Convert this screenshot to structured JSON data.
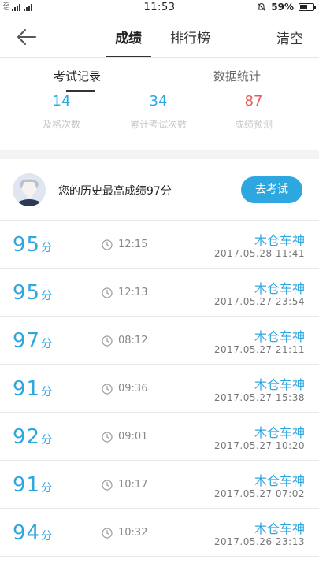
{
  "status_bar": {
    "net_top": "2G",
    "net_bottom": "4G",
    "time": "11:53",
    "battery": "59%",
    "battery_level": 0.59
  },
  "header": {
    "back_icon": "back-arrow-icon",
    "tabs": [
      {
        "label": "成绩",
        "active": true
      },
      {
        "label": "排行榜",
        "active": false
      }
    ],
    "clear_label": "清空"
  },
  "subtabs": [
    {
      "label": "考试记录",
      "active": true
    },
    {
      "label": "数据统计",
      "active": false
    }
  ],
  "stats": [
    {
      "value": "14",
      "label": "及格次数",
      "color": "#2ea7e0"
    },
    {
      "value": "34",
      "label": "累计考试次数",
      "color": "#2ea7e0"
    },
    {
      "value": "87",
      "label": "成绩预测",
      "color": "#e85a5a"
    }
  ],
  "best": {
    "text": "您的历史最高成绩97分",
    "button": "去考试"
  },
  "records": [
    {
      "score": "95",
      "unit": "分",
      "duration": "12:15",
      "name": "木仓车神",
      "date": "2017.05.28  11:41"
    },
    {
      "score": "95",
      "unit": "分",
      "duration": "12:13",
      "name": "木仓车神",
      "date": "2017.05.27  23:54"
    },
    {
      "score": "97",
      "unit": "分",
      "duration": "08:12",
      "name": "木仓车神",
      "date": "2017.05.27  21:11"
    },
    {
      "score": "91",
      "unit": "分",
      "duration": "09:36",
      "name": "木仓车神",
      "date": "2017.05.27  15:38"
    },
    {
      "score": "92",
      "unit": "分",
      "duration": "09:01",
      "name": "木仓车神",
      "date": "2017.05.27  10:20"
    },
    {
      "score": "91",
      "unit": "分",
      "duration": "10:17",
      "name": "木仓车神",
      "date": "2017.05.27  07:02"
    },
    {
      "score": "94",
      "unit": "分",
      "duration": "10:32",
      "name": "木仓车神",
      "date": "2017.05.26  23:13"
    }
  ],
  "colors": {
    "accent": "#2ea7e0",
    "prediction": "#e85a5a"
  }
}
